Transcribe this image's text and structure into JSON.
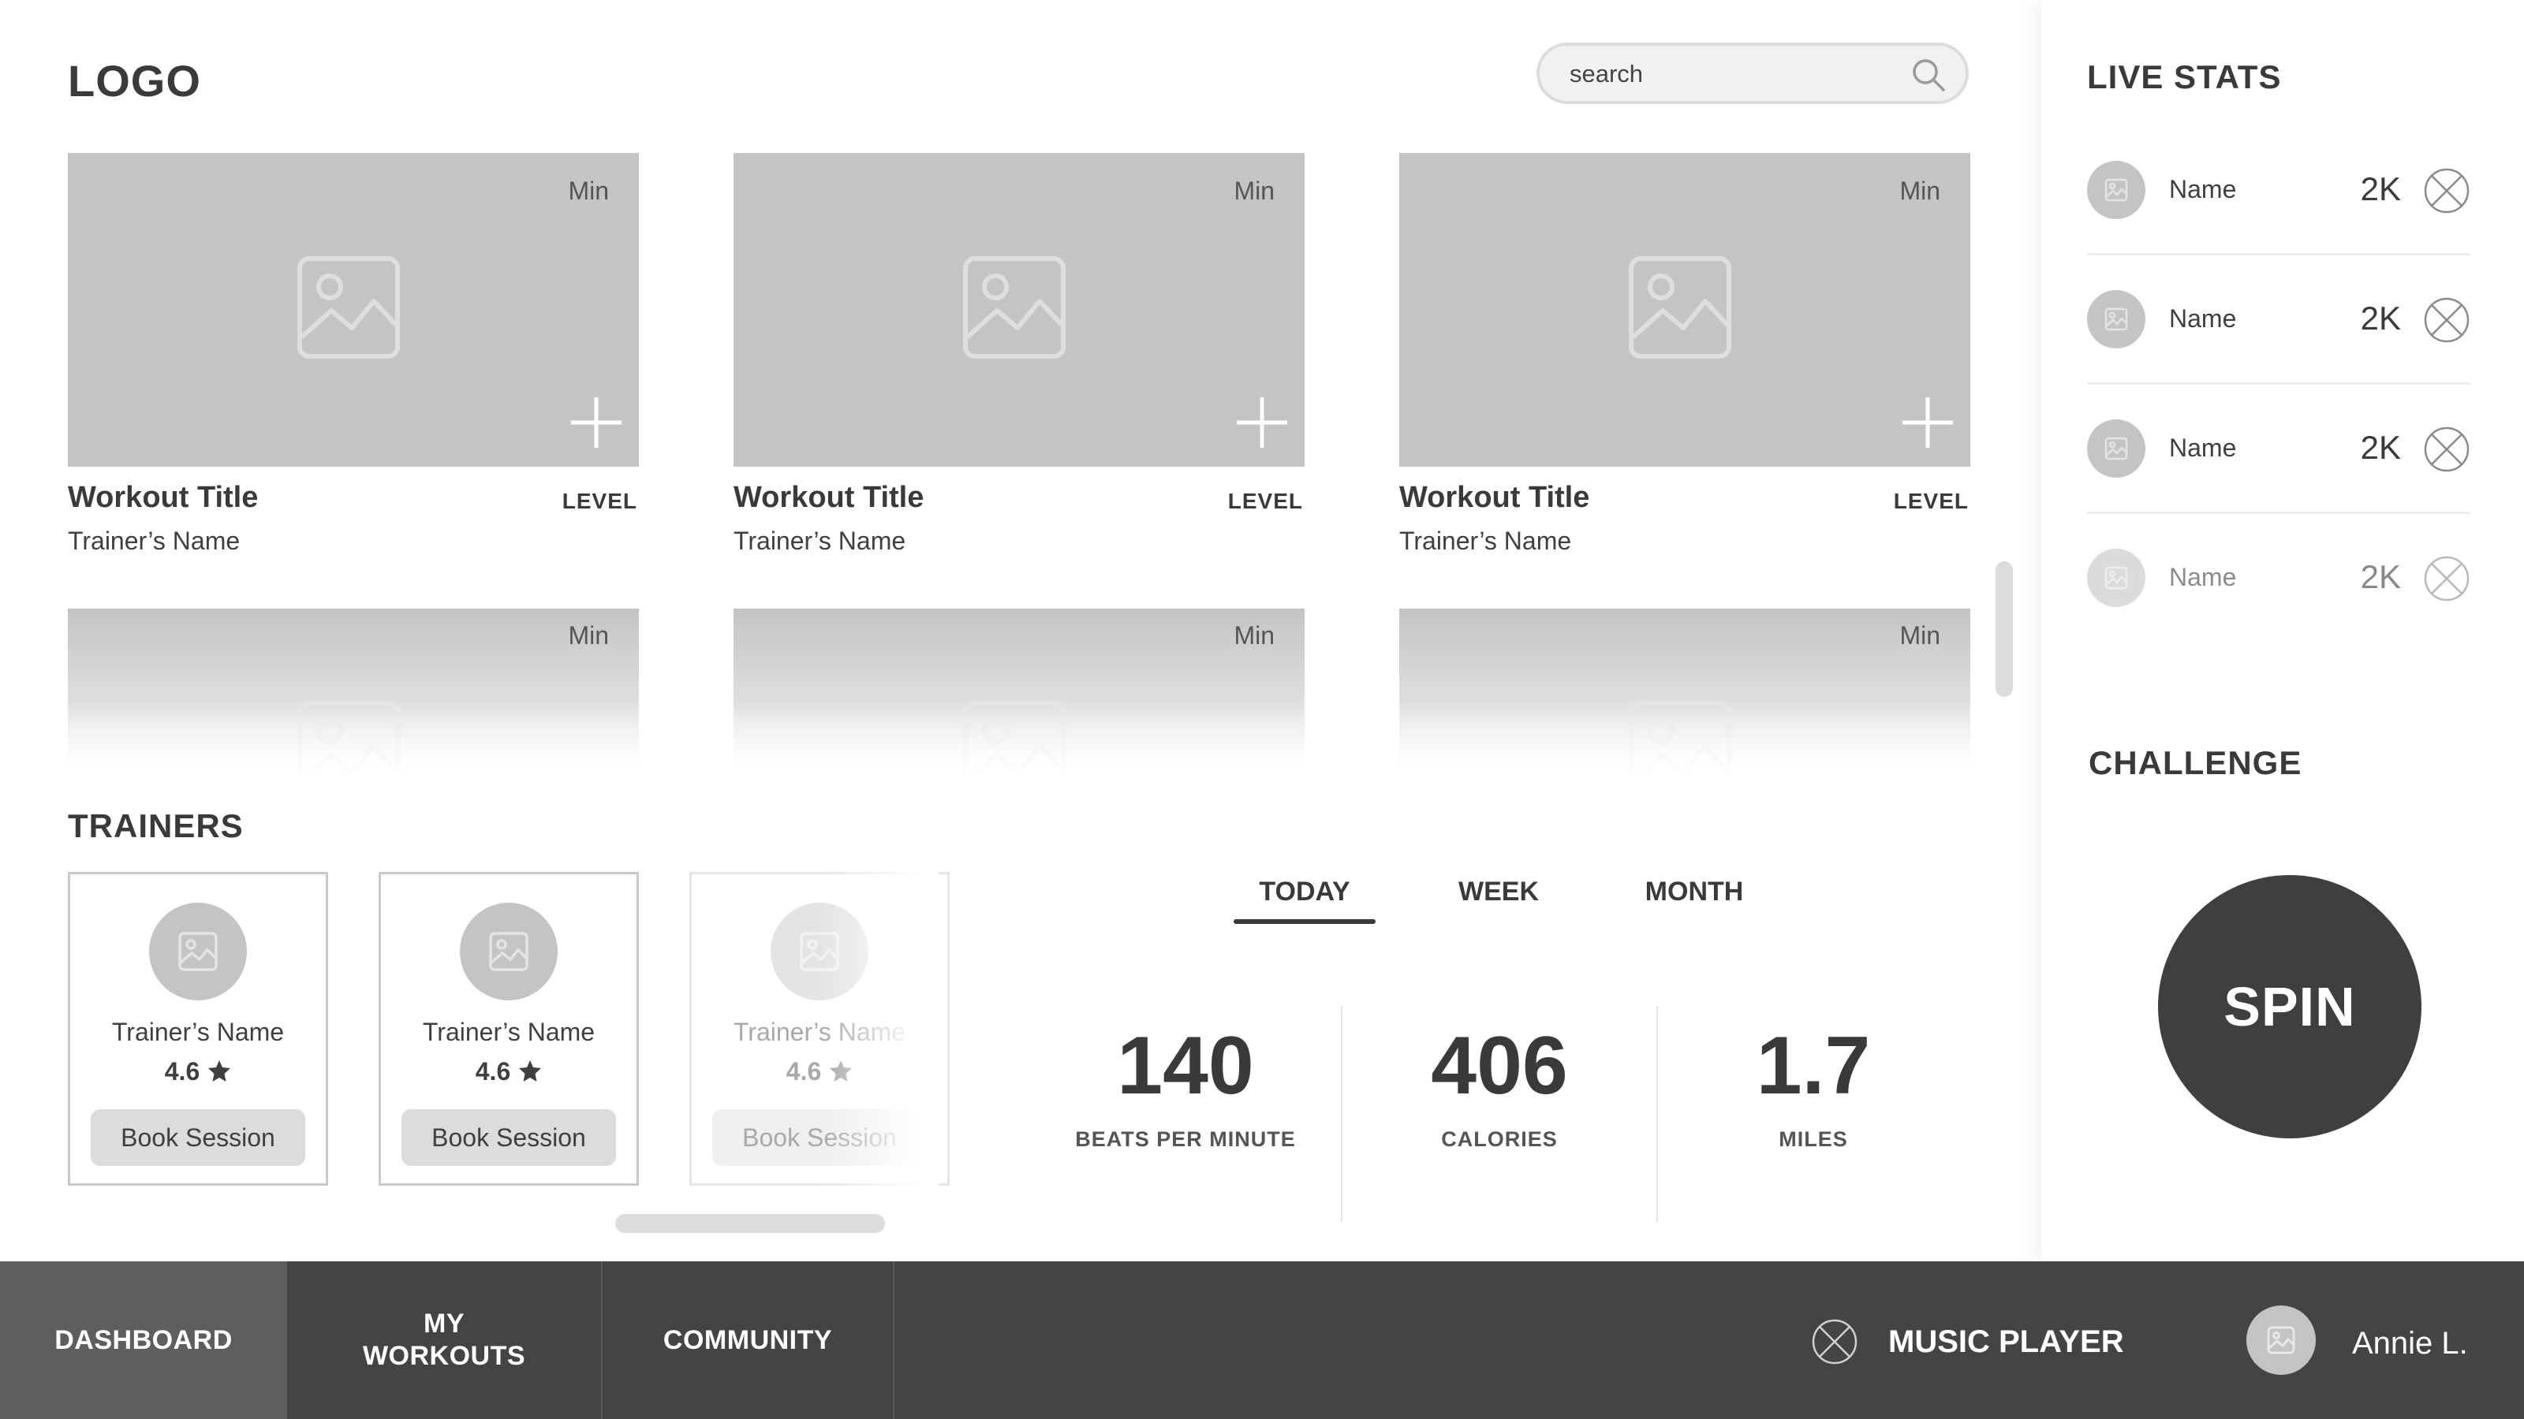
{
  "header": {
    "logo": "LOGO",
    "search_placeholder": "search"
  },
  "workouts": [
    {
      "title": "Workout Title",
      "trainer": "Trainer’s Name",
      "level": "LEVEL",
      "duration": "Min"
    },
    {
      "title": "Workout Title",
      "trainer": "Trainer’s Name",
      "level": "LEVEL",
      "duration": "Min"
    },
    {
      "title": "Workout Title",
      "trainer": "Trainer’s Name",
      "level": "LEVEL",
      "duration": "Min"
    },
    {
      "duration": "Min"
    },
    {
      "duration": "Min"
    },
    {
      "duration": "Min"
    }
  ],
  "trainers": {
    "heading": "TRAINERS",
    "items": [
      {
        "name": "Trainer’s Name",
        "rating": "4.6",
        "book_label": "Book Session"
      },
      {
        "name": "Trainer’s Name",
        "rating": "4.6",
        "book_label": "Book Session"
      },
      {
        "name": "Trainer’s Name",
        "rating": "4.6",
        "book_label": "Book Session"
      }
    ]
  },
  "period_tabs": {
    "items": [
      "TODAY",
      "WEEK",
      "MONTH"
    ],
    "active": "TODAY"
  },
  "stats": [
    {
      "value": "140",
      "label": "BEATS PER MINUTE"
    },
    {
      "value": "406",
      "label": "CALORIES"
    },
    {
      "value": "1.7",
      "label": "MILES"
    }
  ],
  "live_stats": {
    "heading": "LIVE STATS",
    "items": [
      {
        "name": "Name",
        "value": "2K"
      },
      {
        "name": "Name",
        "value": "2K"
      },
      {
        "name": "Name",
        "value": "2K"
      },
      {
        "name": "Name",
        "value": "2K"
      }
    ]
  },
  "challenge": {
    "heading": "CHALLENGE",
    "button_label": "SPIN"
  },
  "bottom_nav": {
    "items": [
      "DASHBOARD",
      "MY\nWORKOUTS",
      "COMMUNITY"
    ],
    "active": "DASHBOARD",
    "music_player_label": "MUSIC PLAYER",
    "user_name": "Annie L."
  },
  "icons": {
    "search": "search-icon",
    "image": "image-placeholder-icon",
    "add": "plus-icon",
    "star": "star-icon",
    "close": "x-circle-icon",
    "avatar": "avatar-placeholder-icon"
  },
  "colors": {
    "dark": "#3f3f3f",
    "placeholder": "#c4c4c4",
    "nav_bg": "#444444",
    "nav_active": "#5e5e5e",
    "button_bg": "#dcdcdc"
  }
}
